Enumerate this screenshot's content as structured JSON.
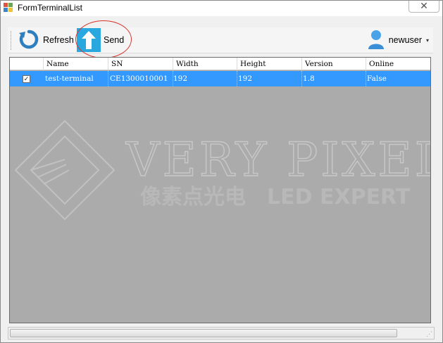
{
  "window": {
    "title": "FormTerminalList",
    "close_glyph": "✕"
  },
  "toolbar": {
    "refresh_label": "Refresh",
    "send_label": "Send",
    "user_label": "newuser",
    "user_caret": "▾"
  },
  "grid": {
    "columns": [
      "Name",
      "SN",
      "Width",
      "Height",
      "Version",
      "Online"
    ],
    "rows": [
      {
        "checked": true,
        "check_glyph": "✓",
        "cells": [
          "test-terminal",
          "CE1300010001",
          "192",
          "192",
          "1.8",
          "False"
        ]
      }
    ]
  },
  "watermark": {
    "brand": "VERY PIXEL",
    "tagline_cn": "像素点光电",
    "tagline_en": "LED EXPERT"
  },
  "statusbar": {
    "grip_glyph": "⋰"
  },
  "colors": {
    "selection": "#3399ff",
    "grid_background": "#ababab",
    "send_icon": "#29a8e0",
    "annotation_circle": "#d9342b"
  }
}
